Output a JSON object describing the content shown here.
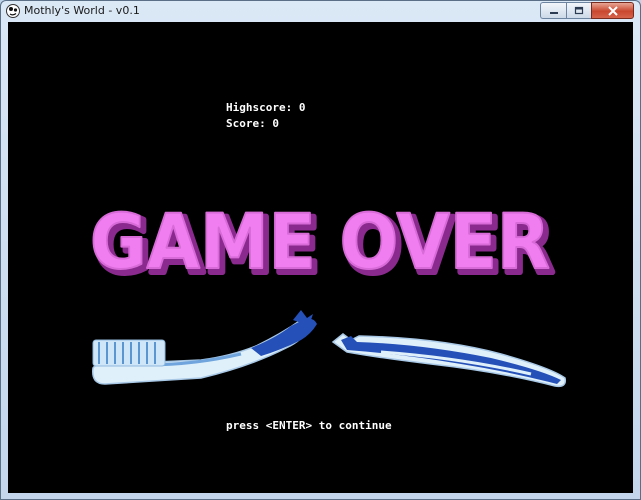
{
  "window": {
    "title": "Mothly's World - v0.1",
    "icon": "app-icon",
    "buttons": [
      "minimize-icon",
      "maximize-icon",
      "close-icon"
    ]
  },
  "game": {
    "highscore_label": "Highscore:",
    "highscore_value": "0",
    "score_label": "Score:",
    "score_value": "0",
    "heading": "GAME OVER",
    "prompt": "press <ENTER> to continue",
    "image": "broken-toothbrush",
    "colors": {
      "background": "#000000",
      "heading_fill": "#f07ef0",
      "heading_shadow": "#8a2a8e",
      "text": "#ffffff",
      "brush_blue": "#2450b8",
      "brush_light": "#dff0fb"
    }
  }
}
